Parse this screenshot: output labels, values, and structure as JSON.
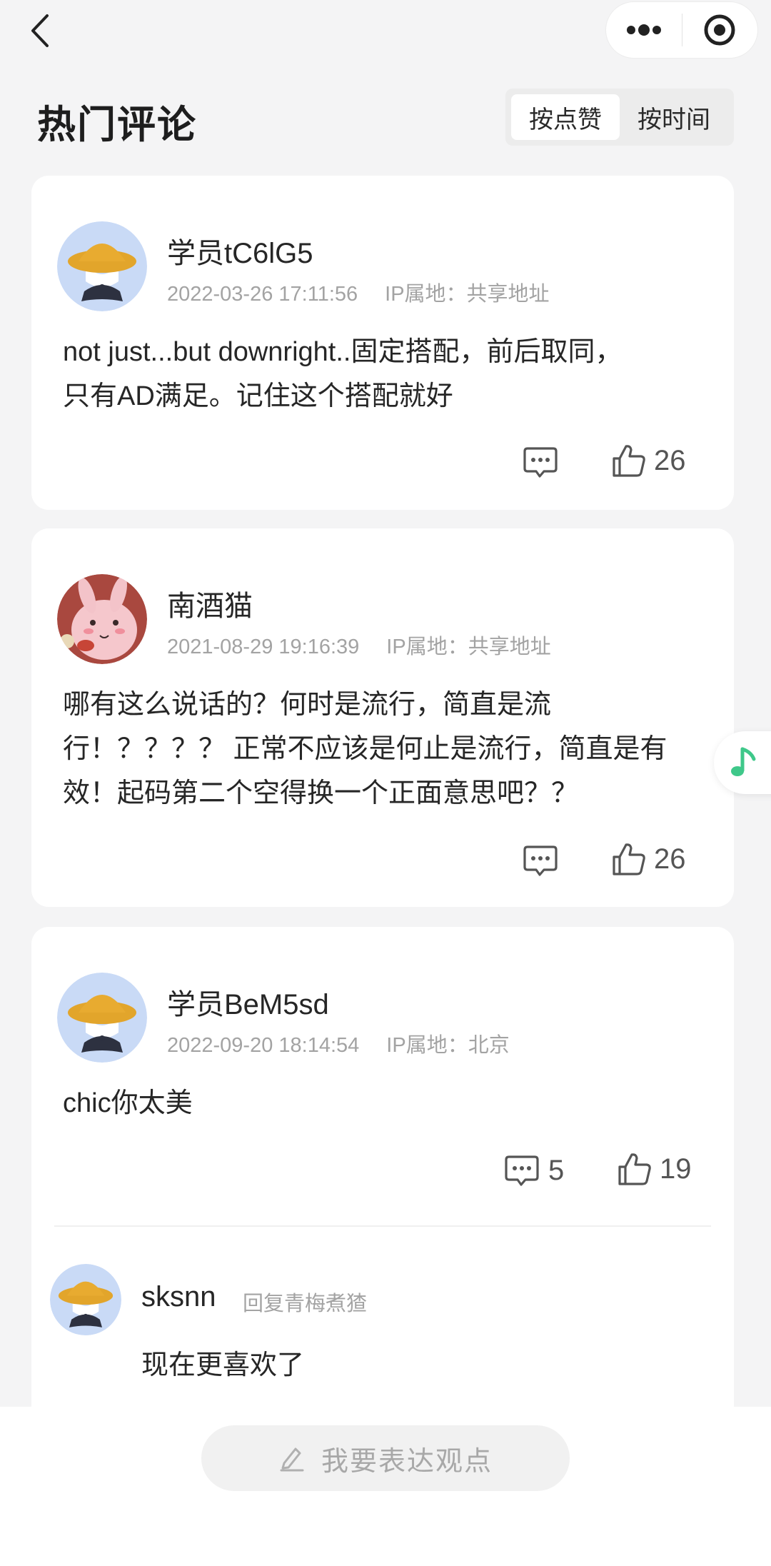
{
  "header": {
    "title": "热门评论",
    "sort_options": [
      "按点赞",
      "按时间"
    ]
  },
  "comments": [
    {
      "username": "学员tC6lG5",
      "timestamp": "2022-03-26 17:11:56",
      "ip": "IP属地：共享地址",
      "text_lines": [
        "not just...but downright..固定搭配，前后取同，",
        "只有AD满足。记住这个搭配就好"
      ],
      "reply_count": "",
      "likes": "26"
    },
    {
      "username": "南酒猫",
      "timestamp": "2021-08-29 19:16:39",
      "ip": "IP属地：共享地址",
      "text_lines": [
        "哪有这么说话的？何时是流行，简直是流",
        "行！？？？？ 正常不应该是何止是流行，简直是有",
        "效！起码第二个空得换一个正面意思吧？？"
      ],
      "reply_count": "",
      "likes": "26"
    },
    {
      "username": "学员BeM5sd",
      "timestamp": "2022-09-20 18:14:54",
      "ip": "IP属地：北京",
      "text_lines": [
        "chic你太美"
      ],
      "reply_count": "5",
      "likes": "19",
      "reply": {
        "username": "sksnn",
        "reply_to": "回复青梅煮猹",
        "text": "现在更喜欢了"
      }
    }
  ],
  "bottom": {
    "opinion_placeholder": "我要表达观点"
  },
  "icons": {
    "back": "chevron-left-icon",
    "more": "more-dots-icon",
    "close": "target-icon",
    "comment": "comment-bubble-icon",
    "like": "thumbs-up-icon",
    "music": "music-note-icon",
    "edit": "pencil-icon"
  },
  "colors": {
    "music_accent": "#3fc88a"
  }
}
